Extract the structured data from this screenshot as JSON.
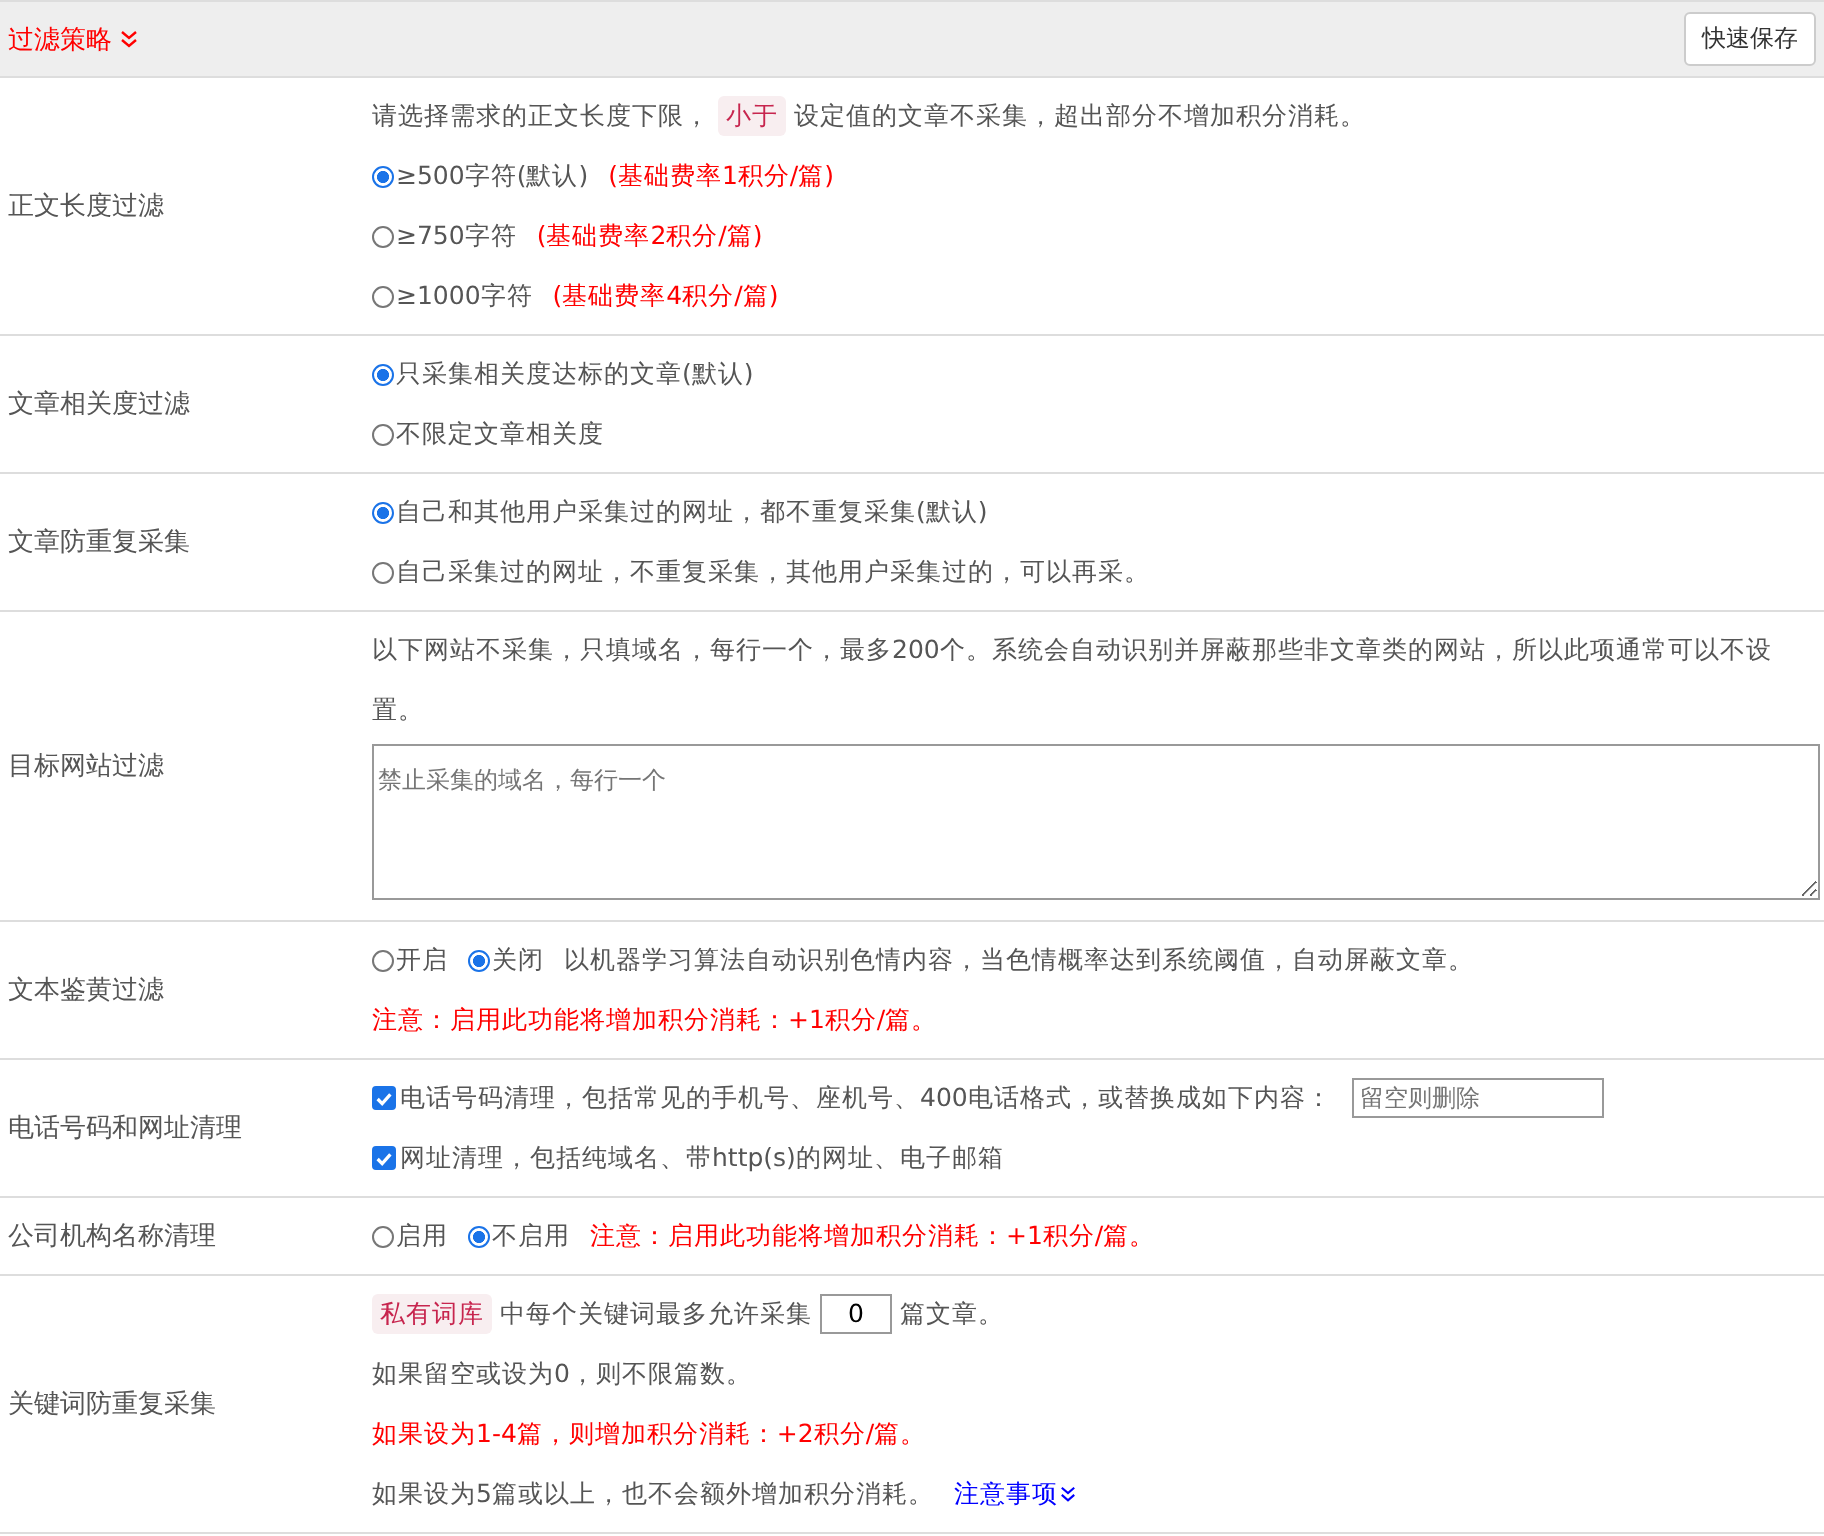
{
  "header": {
    "title": "过滤策略",
    "save_button": "快速保存"
  },
  "sections": [
    {
      "label": "正文长度过滤",
      "lines": [
        {
          "parts": [
            {
              "kind": "text",
              "text": "请选择需求的正文长度下限，"
            },
            {
              "kind": "tag",
              "text": "小于"
            },
            {
              "kind": "text",
              "text": "设定值的文章不采集，超出部分不增加积分消耗。"
            }
          ]
        },
        {
          "parts": [
            {
              "kind": "radio",
              "label": "≥500字符(默认)",
              "selected": true
            },
            {
              "kind": "red",
              "text": "(基础费率1积分/篇)"
            }
          ]
        },
        {
          "parts": [
            {
              "kind": "radio",
              "label": "≥750字符",
              "selected": false
            },
            {
              "kind": "red",
              "text": "(基础费率2积分/篇)"
            }
          ]
        },
        {
          "parts": [
            {
              "kind": "radio",
              "label": "≥1000字符",
              "selected": false
            },
            {
              "kind": "red",
              "text": "(基础费率4积分/篇)"
            }
          ]
        }
      ]
    },
    {
      "label": "文章相关度过滤",
      "lines": [
        {
          "parts": [
            {
              "kind": "radio",
              "label": "只采集相关度达标的文章(默认)",
              "selected": true
            }
          ]
        },
        {
          "parts": [
            {
              "kind": "radio",
              "label": "不限定文章相关度",
              "selected": false
            }
          ]
        }
      ]
    },
    {
      "label": "文章防重复采集",
      "lines": [
        {
          "parts": [
            {
              "kind": "radio",
              "label": "自己和其他用户采集过的网址，都不重复采集(默认)",
              "selected": true
            }
          ]
        },
        {
          "parts": [
            {
              "kind": "radio",
              "label": "自己采集过的网址，不重复采集，其他用户采集过的，可以再采。",
              "selected": false
            }
          ]
        }
      ]
    },
    {
      "label": "目标网站过滤",
      "lines": [
        {
          "parts": [
            {
              "kind": "text",
              "text": "以下网站不采集，只填域名，每行一个，最多200个。系统会自动识别并屏蔽那些非文章类的网站，所以此项通常可以不设置。"
            }
          ]
        },
        {
          "parts": [
            {
              "kind": "textarea",
              "placeholder": "禁止采集的域名，每行一个"
            }
          ]
        }
      ]
    },
    {
      "label": "文本鉴黄过滤",
      "lines": [
        {
          "parts": [
            {
              "kind": "radio",
              "label": "开启",
              "selected": false
            },
            {
              "kind": "radio",
              "label": "关闭",
              "selected": true
            },
            {
              "kind": "text",
              "text": "以机器学习算法自动识别色情内容，当色情概率达到系统阈值，自动屏蔽文章。"
            }
          ]
        },
        {
          "parts": [
            {
              "kind": "red",
              "text": "注意：启用此功能将增加积分消耗：+1积分/篇。"
            }
          ]
        }
      ]
    },
    {
      "label": "电话号码和网址清理",
      "lines": [
        {
          "parts": [
            {
              "kind": "checkbox",
              "label": "电话号码清理，包括常见的手机号、座机号、400电话格式，或替换成如下内容：",
              "checked": true
            },
            {
              "kind": "input",
              "placeholder": "留空则删除"
            }
          ]
        },
        {
          "parts": [
            {
              "kind": "checkbox",
              "label": "网址清理，包括纯域名、带http(s)的网址、电子邮箱",
              "checked": true
            }
          ]
        }
      ]
    },
    {
      "label": "公司机构名称清理",
      "lines": [
        {
          "parts": [
            {
              "kind": "radio",
              "label": "启用",
              "selected": false
            },
            {
              "kind": "radio",
              "label": "不启用",
              "selected": true
            },
            {
              "kind": "red",
              "text": "注意：启用此功能将增加积分消耗：+1积分/篇。"
            }
          ]
        }
      ]
    },
    {
      "label": "关键词防重复采集",
      "lines": [
        {
          "parts": [
            {
              "kind": "tag",
              "text": "私有词库"
            },
            {
              "kind": "text",
              "text": "中每个关键词最多允许采集"
            },
            {
              "kind": "number",
              "value": "0"
            },
            {
              "kind": "text",
              "text": "篇文章。"
            }
          ]
        },
        {
          "parts": [
            {
              "kind": "text",
              "text": "如果留空或设为0，则不限篇数。"
            }
          ]
        },
        {
          "parts": [
            {
              "kind": "red",
              "text": "如果设为1-4篇，则增加积分消耗：+2积分/篇。"
            }
          ]
        },
        {
          "parts": [
            {
              "kind": "text",
              "text": "如果设为5篇或以上，也不会额外增加积分消耗。"
            },
            {
              "kind": "link",
              "text": "注意事项"
            }
          ]
        }
      ]
    }
  ]
}
